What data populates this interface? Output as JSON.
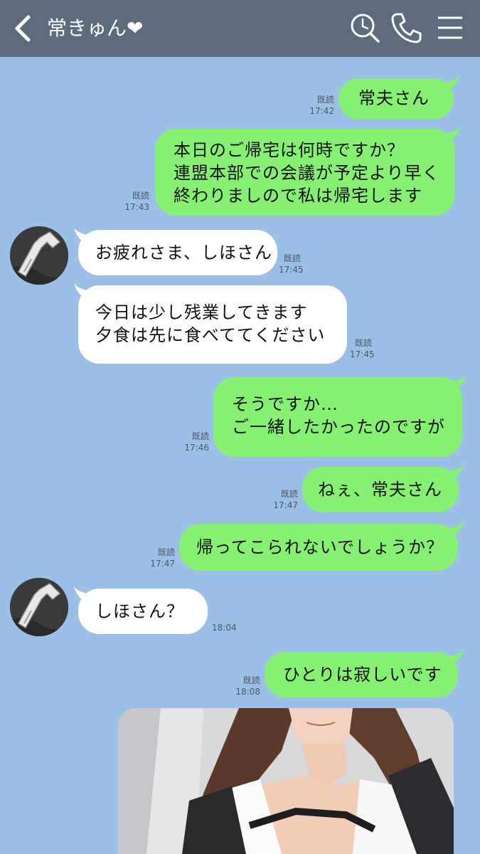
{
  "header": {
    "title": "常きゅん❤",
    "icons": [
      "back-chevron-icon",
      "search-icon",
      "phone-icon",
      "menu-icon"
    ]
  },
  "messages": [
    {
      "from": "me",
      "text": "常夫さん",
      "read": "既読",
      "time": "17:42"
    },
    {
      "from": "me",
      "text": "本日のご帰宅は何時ですか？\n連盟本部での会議が予定より早く\n終わりましので私は帰宅します",
      "read": "既読",
      "time": "17:43"
    },
    {
      "from": "them",
      "text": "お疲れさま、しほさん",
      "read": "既読",
      "time": "17:45"
    },
    {
      "from": "them",
      "text": "今日は少し残業してきます\n夕食は先に食べててください",
      "read": "既読",
      "time": "17:45"
    },
    {
      "from": "me",
      "text": "そうですか…\nご一緒したかったのですが",
      "read": "既読",
      "time": "17:46"
    },
    {
      "from": "me",
      "text": "ねぇ、常夫さん",
      "read": "既読",
      "time": "17:47"
    },
    {
      "from": "me",
      "text": "帰ってこられないでしょうか？",
      "read": "既読",
      "time": "17:47"
    },
    {
      "from": "them",
      "text": "しほさん？",
      "time": "18:04"
    },
    {
      "from": "me",
      "text": "ひとりは寂しいです",
      "read": "既読",
      "time": "18:08"
    }
  ],
  "colors": {
    "background": "#9cbfe6",
    "header": "#5d6b7d",
    "my_bubble": "#85f072",
    "their_bubble": "#ffffff"
  }
}
